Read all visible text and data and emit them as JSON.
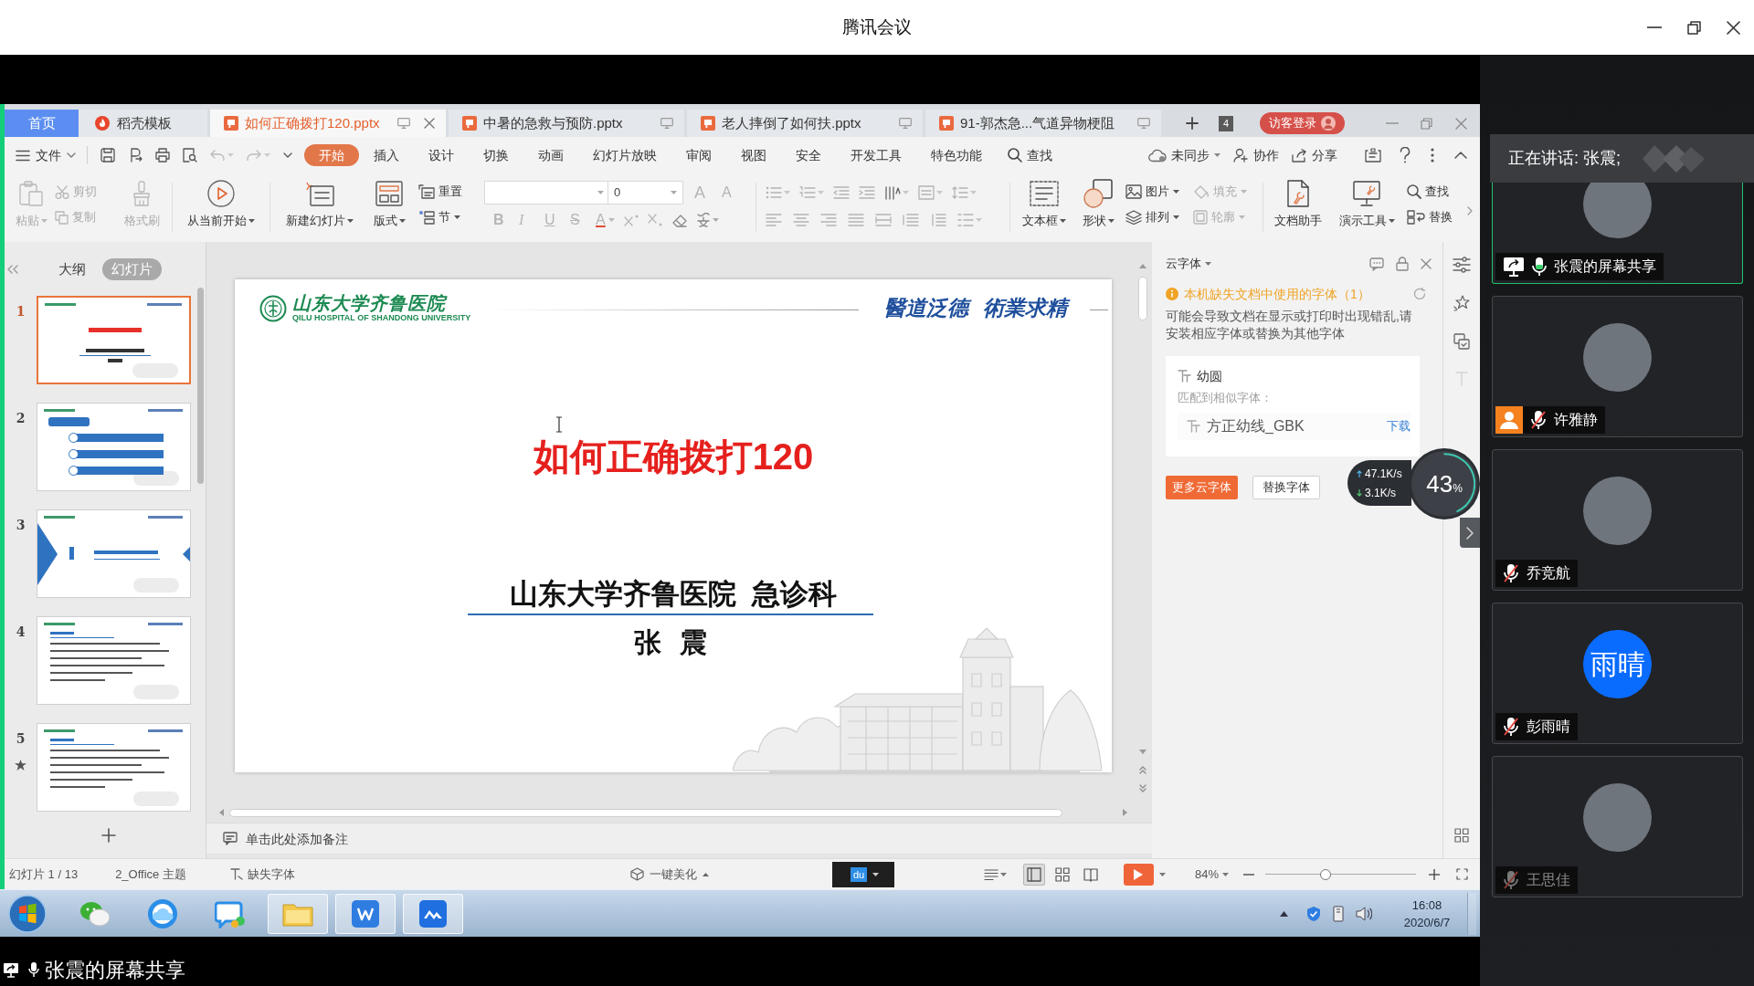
{
  "window": {
    "title": "腾讯会议"
  },
  "wps": {
    "tabs": [
      {
        "label": "首页",
        "kind": "home",
        "selected": false
      },
      {
        "label": "稻壳模板",
        "kind": "docer",
        "selected": false
      },
      {
        "label": "如何正确拨打120.pptx",
        "kind": "pptx",
        "selected": true
      },
      {
        "label": "中暑的急救与预防.pptx",
        "kind": "pptx",
        "selected": false
      },
      {
        "label": "老人摔倒了如何扶.pptx",
        "kind": "pptx",
        "selected": false
      },
      {
        "label": "91-郭杰急...气道异物梗阻",
        "kind": "pptx",
        "selected": false
      }
    ],
    "window_count": "4",
    "login_button": "访客登录",
    "file_menu": "文件",
    "ribbon_tabs": [
      {
        "label": "开始",
        "selected": true
      },
      {
        "label": "插入",
        "selected": false
      },
      {
        "label": "设计",
        "selected": false
      },
      {
        "label": "切换",
        "selected": false
      },
      {
        "label": "动画",
        "selected": false
      },
      {
        "label": "幻灯片放映",
        "selected": false
      },
      {
        "label": "审阅",
        "selected": false
      },
      {
        "label": "视图",
        "selected": false
      },
      {
        "label": "安全",
        "selected": false
      },
      {
        "label": "开发工具",
        "selected": false
      },
      {
        "label": "特色功能",
        "selected": false
      }
    ],
    "search": "查找",
    "cloud_actions": [
      {
        "kind": "sync",
        "label": "未同步"
      },
      {
        "kind": "collab",
        "label": "协作"
      },
      {
        "kind": "share",
        "label": "分享"
      }
    ],
    "ribbon": {
      "paste": {
        "label": "粘贴",
        "disabled": true
      },
      "cut": {
        "label": "剪切",
        "disabled": true
      },
      "copy": {
        "label": "复制",
        "disabled": true
      },
      "format_painter": {
        "label": "格式刷",
        "disabled": true
      },
      "play_from_current": {
        "label": "从当前开始",
        "disabled": false
      },
      "new_slide": {
        "label": "新建幻灯片",
        "disabled": false
      },
      "layout": {
        "label": "版式",
        "disabled": false
      },
      "reset": {
        "label": "重置",
        "disabled": false
      },
      "section": {
        "label": "节",
        "disabled": false
      },
      "font_size": {
        "value": "0"
      },
      "font_scale": [
        {
          "kind": "grow",
          "label": "A",
          "disabled": true
        },
        {
          "kind": "shrink",
          "label": "A",
          "disabled": true
        }
      ],
      "text_format": [
        {
          "kind": "bold",
          "label": "B",
          "disabled": true
        },
        {
          "kind": "italic",
          "label": "I",
          "disabled": true
        },
        {
          "kind": "underline",
          "label": "U",
          "disabled": true
        },
        {
          "kind": "strike",
          "label": "S",
          "disabled": true
        },
        {
          "kind": "color",
          "label": "A",
          "disabled": true
        }
      ],
      "text_box": {
        "label": "文本框",
        "disabled": false
      },
      "shapes": {
        "label": "形状",
        "disabled": false
      },
      "picture": {
        "label": "图片",
        "disabled": false
      },
      "fill": {
        "label": "填充",
        "disabled": true
      },
      "arrange": {
        "label": "排列",
        "disabled": false
      },
      "outline": {
        "label": "轮廓",
        "disabled": true
      },
      "doc_assistant": {
        "label": "文档助手",
        "disabled": false
      },
      "presentation_tools": {
        "label": "演示工具",
        "disabled": false
      },
      "find": {
        "label": "查找",
        "disabled": false
      },
      "replace": {
        "label": "替换",
        "disabled": false
      }
    },
    "panel_tabs": [
      {
        "label": "大纲",
        "selected": false
      },
      {
        "label": "幻灯片",
        "selected": true
      }
    ],
    "slides": [
      {
        "number": "1",
        "kind": "title",
        "selected": true,
        "animated": false
      },
      {
        "number": "2",
        "kind": "agenda",
        "selected": false,
        "animated": false
      },
      {
        "number": "3",
        "kind": "section",
        "selected": false,
        "animated": false
      },
      {
        "number": "4",
        "kind": "text",
        "selected": false,
        "animated": false
      },
      {
        "number": "5",
        "kind": "text",
        "selected": false,
        "animated": true
      }
    ],
    "slide": {
      "hospital_name": "山东大学齐鲁医院",
      "hospital_name_en": "QILU HOSPITAL OF SHANDONG UNIVERSITY",
      "motto": "醫道泛德  術業求精",
      "title": "如何正确拨打120",
      "department": "山东大学齐鲁医院  急诊科",
      "presenter": "张 震"
    },
    "notes": {
      "placeholder": "单击此处添加备注"
    },
    "cloud_fonts": {
      "title": "云字体",
      "warning": "本机缺失文档中使用的字体（1）",
      "description": "可能会导致文档在显示或打印时出现错乱,请安装相应字体或替换为其他字体",
      "missing_font": "幼圆",
      "match_label": "匹配到相似字体：",
      "match_font": "方正幼线_GBK",
      "download": "下载",
      "more_button": "更多云字体",
      "replace_button": "替换字体"
    },
    "net_monitor": {
      "upload": "47.1K/s",
      "download": "3.1K/s",
      "value": "43",
      "unit": "%"
    },
    "status_bar": {
      "slide_counter": "幻灯片 1 / 13",
      "theme": "2_Office 主题",
      "missing_fonts": "缺失字体",
      "beautify": "一键美化",
      "ime": "du",
      "views": [
        {
          "kind": "normal",
          "selected": true
        },
        {
          "kind": "sorter",
          "selected": false
        },
        {
          "kind": "reading",
          "selected": false
        }
      ],
      "zoom": "84%",
      "zoom_slider": {
        "level": 0.4
      }
    },
    "taskbar": {
      "apps": [
        {
          "kind": "wechat",
          "running": false
        },
        {
          "kind": "browser",
          "running": false
        },
        {
          "kind": "chat",
          "running": false
        },
        {
          "kind": "explorer",
          "running": true
        },
        {
          "kind": "writer",
          "running": true
        },
        {
          "kind": "meeting",
          "running": true
        }
      ],
      "time": "16:08",
      "date": "2020/6/7"
    }
  },
  "share_caption": "张震的屏幕共享",
  "speaking": "正在讲话: 张震;",
  "participants": [
    {
      "name": "张震的屏幕共享",
      "kind": "screen_share",
      "avatar": {
        "kind": "photo"
      },
      "muted": false,
      "host": false,
      "dimmed": false,
      "selected": true
    },
    {
      "name": "许雅静",
      "kind": "user",
      "avatar": {
        "kind": "photo"
      },
      "muted": true,
      "host": true,
      "dimmed": false,
      "selected": false
    },
    {
      "name": "乔竞航",
      "kind": "user",
      "avatar": {
        "kind": "photo"
      },
      "muted": true,
      "host": false,
      "dimmed": false,
      "selected": false
    },
    {
      "name": "彭雨晴",
      "kind": "user",
      "avatar": {
        "kind": "text",
        "text": "雨晴"
      },
      "muted": true,
      "host": false,
      "dimmed": false,
      "selected": false
    },
    {
      "name": "王思佳",
      "kind": "user",
      "avatar": {
        "kind": "photo"
      },
      "muted": true,
      "host": false,
      "dimmed": true,
      "selected": false
    }
  ]
}
